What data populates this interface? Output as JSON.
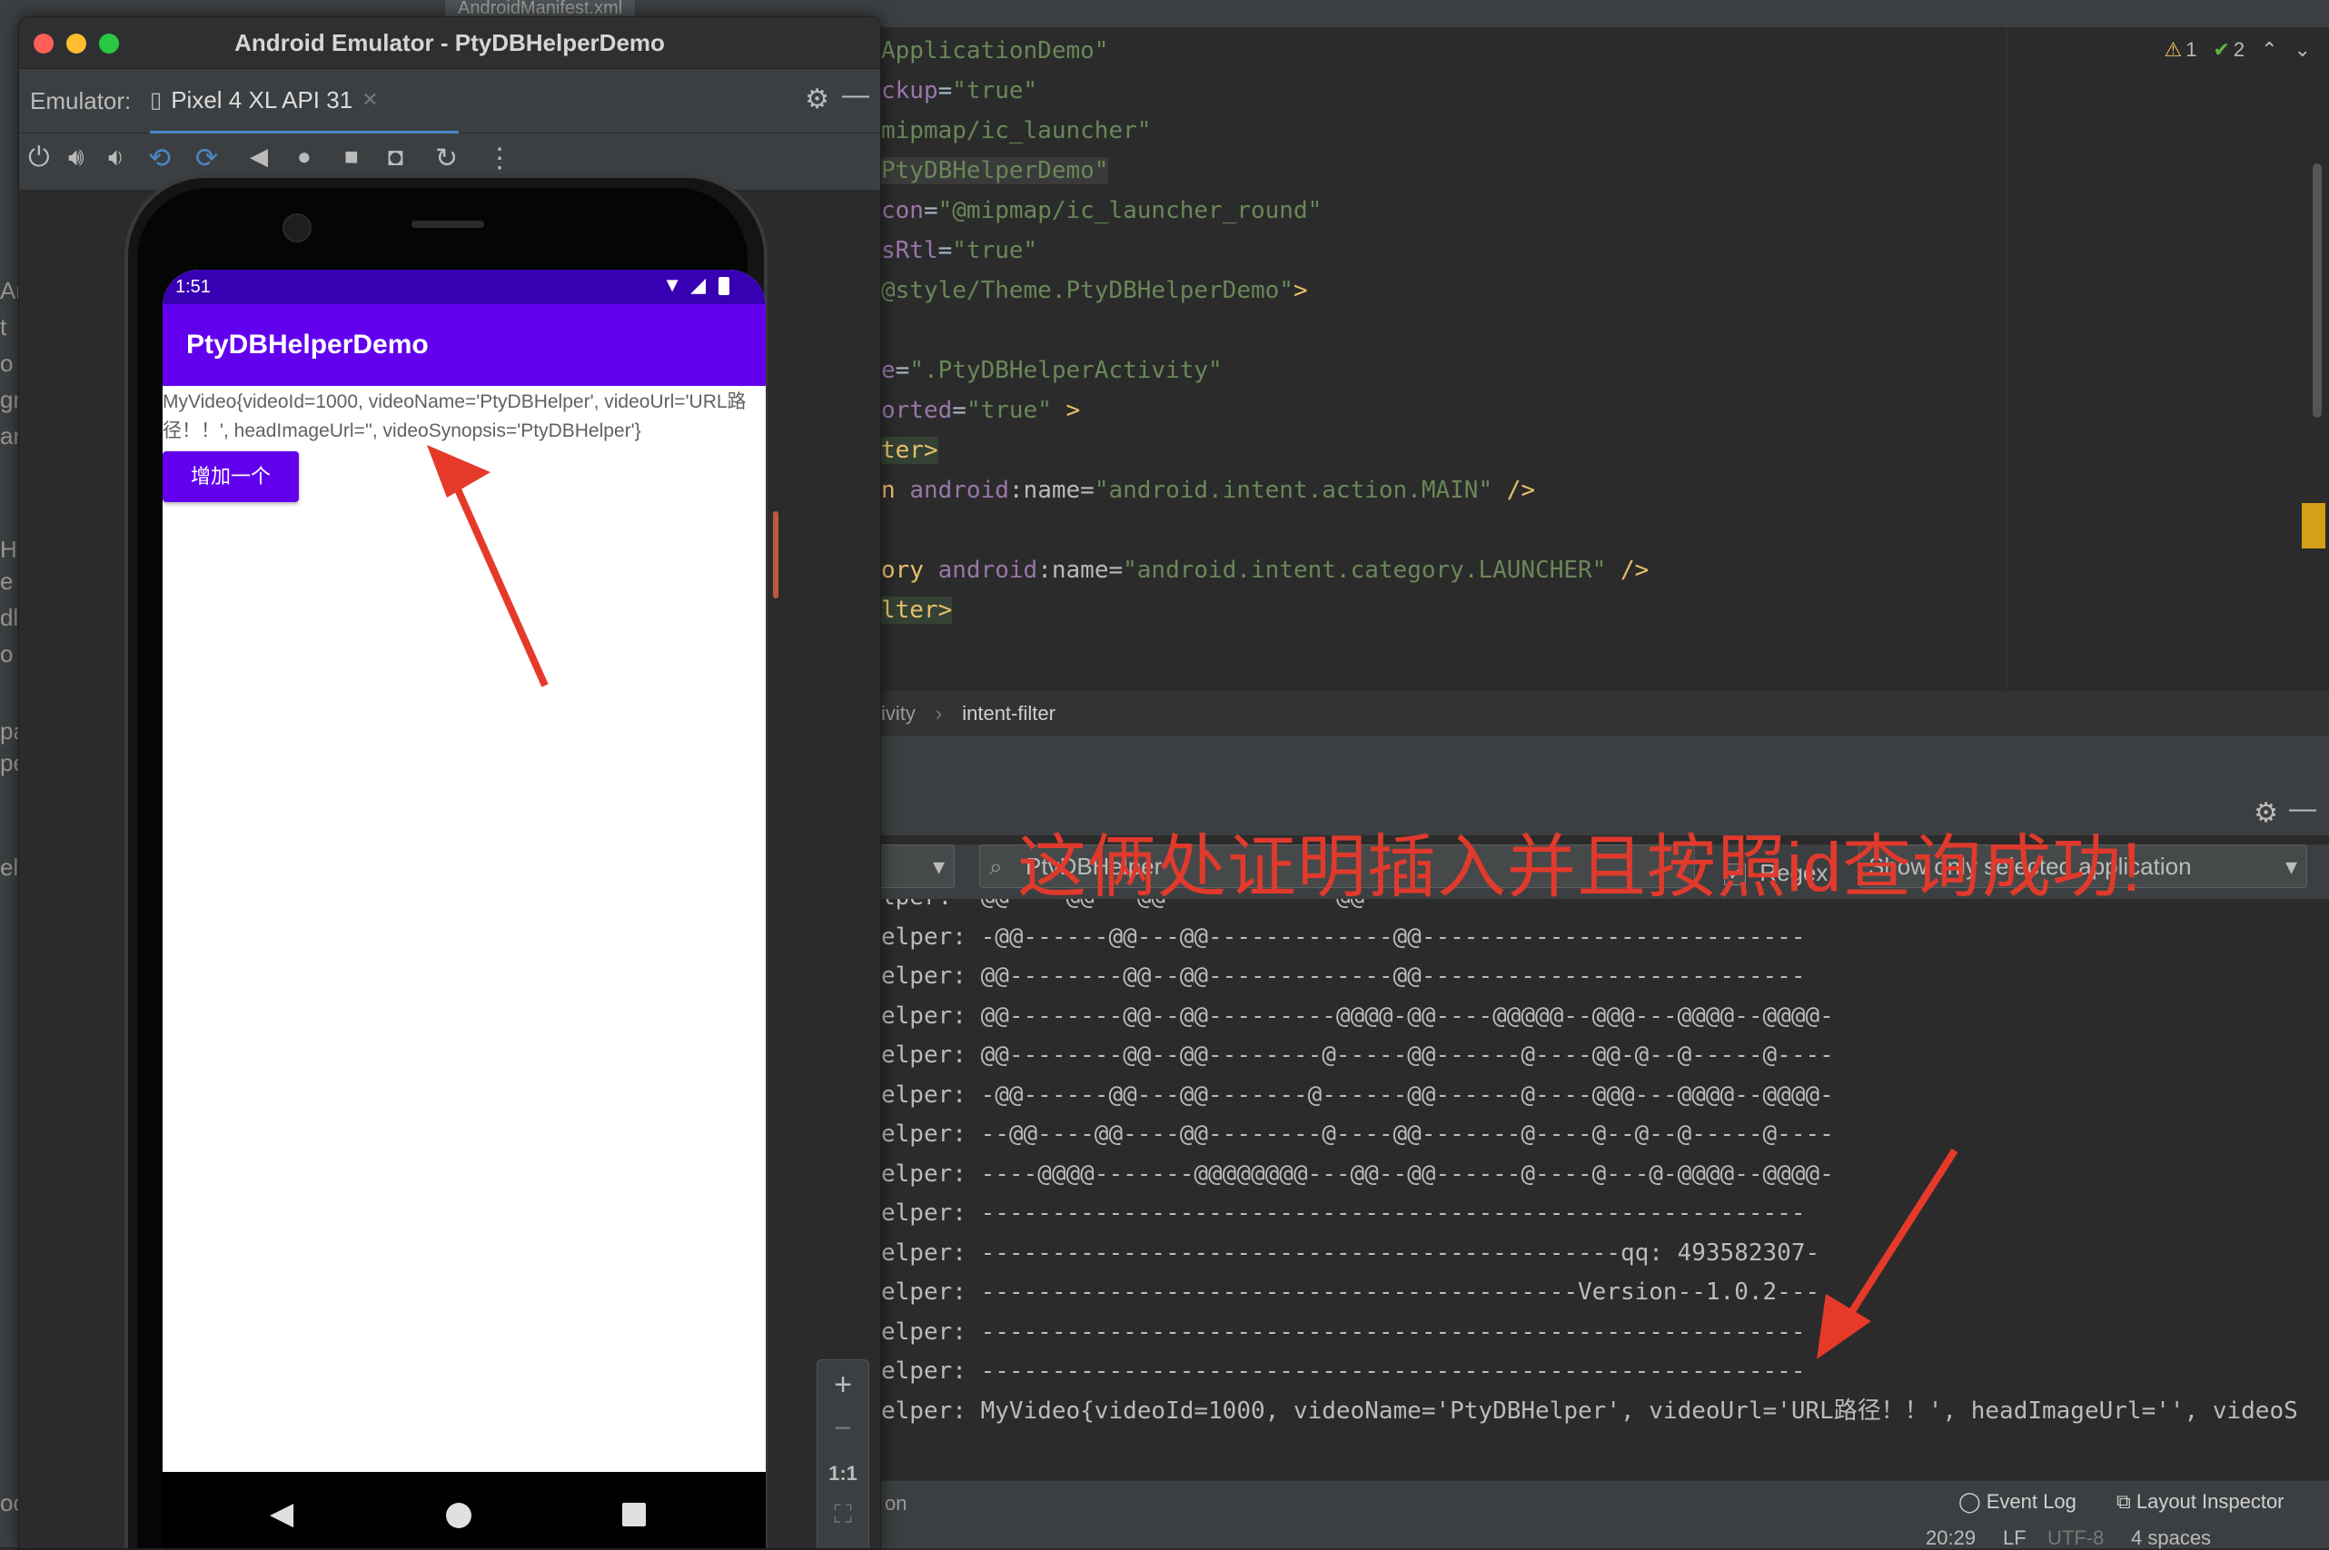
{
  "ide": {
    "top_tab": "AndroidManifest.xml",
    "left_strip": [
      "Ar",
      "t",
      "o",
      "gr",
      "ar",
      "H",
      "e",
      "dl",
      "o",
      "pa",
      "pe",
      "el_",
      "oo"
    ],
    "code_lines": [
      {
        "parts": [
          {
            "t": "ApplicationDemo\"",
            "c": "c-str"
          }
        ]
      },
      {
        "parts": [
          {
            "t": "ckup",
            "c": "c-ns"
          },
          {
            "t": "=",
            "c": ""
          },
          {
            "t": "\"true\"",
            "c": "c-str"
          }
        ]
      },
      {
        "parts": [
          {
            "t": "mipmap/ic_launcher\"",
            "c": "c-str"
          }
        ]
      },
      {
        "parts": [
          {
            "t": "PtyDBHelperDemo\"",
            "c": "c-str hl2"
          }
        ]
      },
      {
        "parts": [
          {
            "t": "con",
            "c": "c-ns"
          },
          {
            "t": "=",
            "c": ""
          },
          {
            "t": "\"@mipmap/ic_launcher_round\"",
            "c": "c-str"
          }
        ]
      },
      {
        "parts": [
          {
            "t": "sRtl",
            "c": "c-ns"
          },
          {
            "t": "=",
            "c": ""
          },
          {
            "t": "\"true\"",
            "c": "c-str"
          }
        ]
      },
      {
        "parts": [
          {
            "t": "@style/Theme.PtyDBHelperDemo\"",
            "c": "c-str"
          },
          {
            "t": ">",
            "c": "c-tag"
          }
        ]
      },
      {
        "parts": []
      },
      {
        "parts": [
          {
            "t": "e",
            "c": "c-ns"
          },
          {
            "t": "=",
            "c": ""
          },
          {
            "t": "\".PtyDBHelperActivity\"",
            "c": "c-str"
          }
        ]
      },
      {
        "parts": [
          {
            "t": "orted",
            "c": "c-ns"
          },
          {
            "t": "=",
            "c": ""
          },
          {
            "t": "\"true\"",
            "c": "c-str"
          },
          {
            "t": " >",
            "c": "c-tag"
          }
        ]
      },
      {
        "parts": [
          {
            "t": "ter>",
            "c": "c-tag hl"
          }
        ]
      },
      {
        "parts": [
          {
            "t": "n ",
            "c": "c-tag"
          },
          {
            "t": "android",
            "c": "c-ns"
          },
          {
            "t": ":name=",
            "c": "c-attr"
          },
          {
            "t": "\"android.intent.action.MAIN\"",
            "c": "c-str"
          },
          {
            "t": " />",
            "c": "c-tag"
          }
        ]
      },
      {
        "parts": []
      },
      {
        "parts": [
          {
            "t": "ory ",
            "c": "c-tag"
          },
          {
            "t": "android",
            "c": "c-ns"
          },
          {
            "t": ":name=",
            "c": "c-attr"
          },
          {
            "t": "\"android.intent.category.LAUNCHER\"",
            "c": "c-str"
          },
          {
            "t": " />",
            "c": "c-tag"
          }
        ]
      },
      {
        "parts": [
          {
            "t": "lter>",
            "c": "c-tag hl"
          }
        ]
      }
    ],
    "warnings": "1",
    "checks": "2",
    "breadcrumb": [
      "ivity",
      "›",
      "intent-filter"
    ],
    "logcat": {
      "filter_search": "PtyDBHelper",
      "regex_label": "Regex",
      "app_filter": "Show only selected application",
      "lines": [
        "lper:  @@    @@   @@            @@",
        "elper: -@@------@@---@@-------------@@---------------------------",
        "elper: @@--------@@--@@-------------@@---------------------------",
        "elper: @@--------@@--@@---------@@@@-@@----@@@@@--@@@---@@@@--@@@@-",
        "elper: @@--------@@--@@--------@-----@@------@----@@-@--@-----@----",
        "elper: -@@------@@---@@-------@------@@------@----@@@---@@@@--@@@@-",
        "elper: --@@----@@----@@--------@----@@-------@----@--@--@-----@----",
        "elper: ----@@@@-------@@@@@@@@---@@--@@------@----@---@-@@@@--@@@@-",
        "elper: ----------------------------------------------------------",
        "elper: ---------------------------------------------qq: 493582307-",
        "elper: ------------------------------------------Version--1.0.2---",
        "elper: ----------------------------------------------------------",
        "elper: ----------------------------------------------------------",
        "elper: MyVideo{videoId=1000, videoName='PtyDBHelper', videoUrl='URL路径！！', headImageUrl='', videoS"
      ]
    },
    "status": {
      "left": "on",
      "event_log": "Event Log",
      "layout_inspector": "Layout Inspector",
      "time": "20:29",
      "lf": "LF",
      "encoding": "UTF-8",
      "indent": "4 spaces"
    }
  },
  "emulator": {
    "window_title": "Android Emulator - PtyDBHelperDemo",
    "label": "Emulator:",
    "device_tab": "Pixel 4 XL API 31",
    "zoom_ratio": "1:1"
  },
  "phone": {
    "time": "1:51",
    "app_title": "PtyDBHelperDemo",
    "result_text": "MyVideo{videoId=1000, videoName='PtyDBHelper', videoUrl='URL路径！！', headImageUrl='', videoSynopsis='PtyDBHelper'}",
    "add_button": "增加一个"
  },
  "annotation": "这俩处证明插入并且按照id查询成功!",
  "colors": {
    "app_primary": "#6200ee",
    "status_bar": "#3700b3",
    "annotation_red": "#e03a2c"
  }
}
